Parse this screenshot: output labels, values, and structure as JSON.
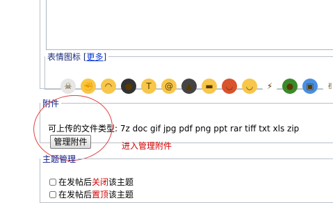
{
  "emoticons": {
    "legend": "表情图标",
    "more_open": "[",
    "more_label": "更多",
    "more_close": "]",
    "items": [
      {
        "icon": "skull-icon",
        "glyph": "☠",
        "color": "#e6e6e6"
      },
      {
        "icon": "fist-icon",
        "glyph": "✊",
        "color": "#f7c64a"
      },
      {
        "icon": "smile-icon",
        "glyph": "◠",
        "color": "#f7c64a"
      },
      {
        "icon": "penguin-icon",
        "glyph": "●",
        "color": "#333333"
      },
      {
        "icon": "crying-icon",
        "glyph": "T",
        "color": "#f7c64a"
      },
      {
        "icon": "dizzy-icon",
        "glyph": "@",
        "color": "#f7c64a"
      },
      {
        "icon": "ninja-icon",
        "glyph": "▲",
        "color": "#444444"
      },
      {
        "icon": "grin-icon",
        "glyph": "▬",
        "color": "#f7c64a"
      },
      {
        "icon": "rice-bowl-icon",
        "glyph": "◡",
        "color": "#d9532c"
      },
      {
        "icon": "happy-icon",
        "glyph": "◡",
        "color": "#f7c64a"
      },
      {
        "icon": "lightning-icon",
        "glyph": "⚡",
        "color": "#ffffff"
      },
      {
        "icon": "turtle-icon",
        "glyph": "●",
        "color": "#3a8a2a"
      },
      {
        "icon": "gift-icon",
        "glyph": "▣",
        "color": "#4a90e2"
      },
      {
        "icon": "victory-hand-icon",
        "glyph": "✌",
        "color": "#ffffff"
      }
    ]
  },
  "attachment": {
    "legend": "附件",
    "types_label": "可上传的文件类型:",
    "types_value": " 7z doc gif jpg pdf png ppt rar tiff txt xls zip",
    "manage_button": "管理附件",
    "enter_manage_link": "进入管理附件"
  },
  "topic_management": {
    "legend": "主题管理",
    "close_prefix": "在发帖后",
    "close_highlight": "关闭",
    "close_suffix": "该主题",
    "top_prefix": "在发帖后",
    "top_highlight": "置顶",
    "top_suffix": "该主题"
  },
  "colors": {
    "highlight_red": "#d40000",
    "link_blue": "#0b3ad6",
    "legend_navy": "#0a1a8a"
  }
}
